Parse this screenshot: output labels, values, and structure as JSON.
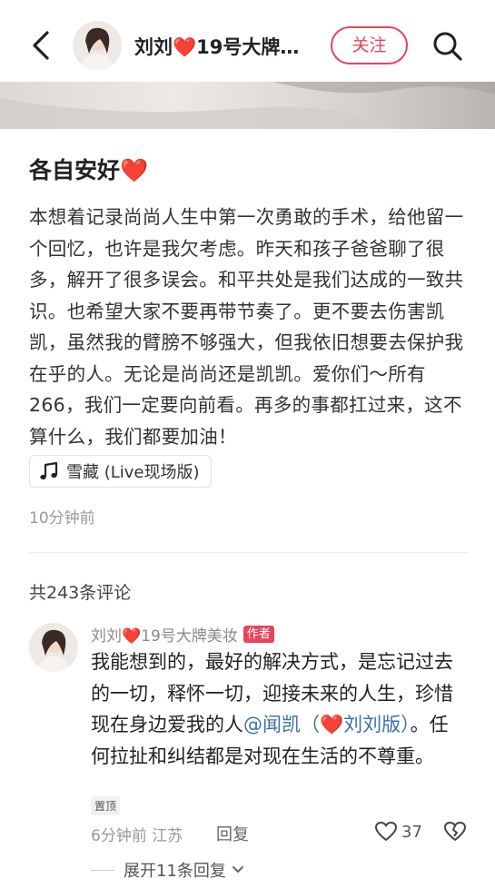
{
  "header": {
    "author_name": "刘刘❤️19号大牌…",
    "follow_label": "关注"
  },
  "post": {
    "title": "各自安好❤️",
    "body": "本想着记录尚尚人生中第一次勇敢的手术，给他留一个回忆，也许是我欠考虑。昨天和孩子爸爸聊了很多，解开了很多误会。和平共处是我们达成的一致共识。也希望大家不要再带节奏了。更不要去伤害凯凯，虽然我的臂膀不够强大，但我依旧想要去保护我在乎的人。无论是尚尚还是凯凯。爱你们～所有266，我们一定要向前看。再多的事都扛过来，这不算什么，我们都要加油！",
    "music": "雪藏 (Live现场版)",
    "time": "10分钟前"
  },
  "comments": {
    "count_label": "共243条评论",
    "items": [
      {
        "author": "刘刘❤️19号大牌美妆",
        "author_badge": "作者",
        "text_before": "我能想到的，最好的解决方式，是忘记过去的一切，释怀一切，迎接未来的人生，珍惜现在身边爱我的人",
        "mention": "@闻凯（❤️刘刘版）",
        "text_after": "。任何拉扯和纠结都是对现在生活的不尊重。",
        "pin_label": "置顶",
        "time_location": "6分钟前 江苏",
        "reply_label": "回复",
        "likes": "37",
        "expand_label": "展开11条回复"
      }
    ]
  }
}
